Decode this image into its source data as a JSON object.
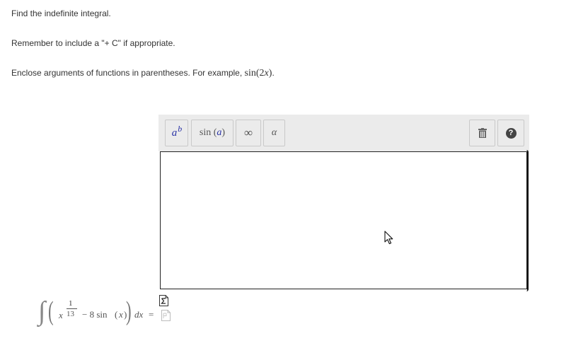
{
  "instructions": {
    "line1": "Find the indefinite integral.",
    "line2": "Remember to include a \"+ C\" if appropriate.",
    "line3_text": "Enclose arguments of functions in parentheses. For example,",
    "line3_example_fn": "sin",
    "line3_example_arg": "(2",
    "line3_example_var": "x",
    "line3_example_close": ")",
    "line3_end": "."
  },
  "toolbar": {
    "power_base": "a",
    "power_exp": "b",
    "function_name": "sin",
    "function_open": "(",
    "function_arg": "a",
    "function_close": ")",
    "infinity": "∞",
    "greek": "α",
    "icons": [
      "power-icon",
      "function-icon",
      "infinity-icon",
      "greek-alpha-icon",
      "trash-icon",
      "help-icon"
    ],
    "help_label": "?"
  },
  "equation": {
    "integral": "∫",
    "open_paren": "(",
    "var1": "x",
    "exp_numerator": "1",
    "exp_denominator": "13",
    "minus_term": "− 8 sin",
    "arg_open": "(",
    "arg_var": "x",
    "arg_close": ")",
    "close_paren": ")",
    "differential": "dx",
    "equals": "="
  },
  "colors": {
    "toolbar_bg": "#ebebeb",
    "math_blue": "#2a33a6",
    "text": "#333333"
  }
}
